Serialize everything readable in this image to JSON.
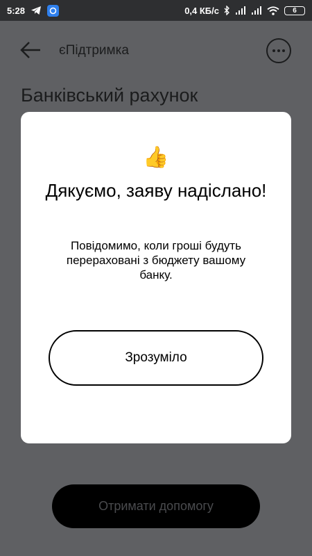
{
  "status_bar": {
    "time": "5:28",
    "network_speed": "0,4 КБ/с",
    "battery": "6"
  },
  "header": {
    "title": "єПідтримка"
  },
  "page": {
    "title": "Банківський рахунок",
    "help_button_label": "Отримати допомогу"
  },
  "modal": {
    "icon": "👍",
    "title": "Дякуємо, заяву надіслано!",
    "message": "Повідомимо, коли гроші будуть перераховані з бюджету вашому банку.",
    "button_label": "Зрозуміло"
  },
  "colors": {
    "overlay_background": "#5f6063",
    "modal_background": "#ffffff",
    "status_bar": "#2e2f31"
  }
}
